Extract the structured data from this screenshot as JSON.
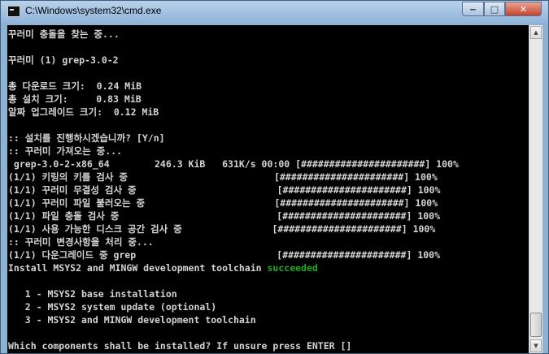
{
  "window": {
    "title": "C:\\Windows\\system32\\cmd.exe",
    "minimize_icon": "minimize-icon",
    "maximize_icon": "maximize-icon",
    "close_icon": "close-icon"
  },
  "console": {
    "lines": [
      {
        "text": "꾸러미 충돌을 찾는 중..."
      },
      {
        "text": ""
      },
      {
        "text": "꾸러미 (1) grep-3.0-2"
      },
      {
        "text": ""
      },
      {
        "text": "총 다운로드 크기:  0.24 MiB"
      },
      {
        "text": "총 설치 크기:     0.83 MiB"
      },
      {
        "text": "알짜 업그레이드 크기:  0.12 MiB"
      },
      {
        "text": ""
      },
      {
        "text": ":: 설치를 진행하시겠습니까? [Y/n]"
      },
      {
        "text": ":: 꾸러미 가져오는 중..."
      },
      {
        "text": " grep-3.0-2-x86_64        246.3 KiB   631K/s 00:00 [######################] 100%"
      },
      {
        "text": "(1/1) 키링의 키를 검사 중                          [######################] 100%"
      },
      {
        "text": "(1/1) 꾸러미 무결성 검사 중                         [######################] 100%"
      },
      {
        "text": "(1/1) 꾸러미 파일 불러오는 중                       [######################] 100%"
      },
      {
        "text": "(1/1) 파일 충돌 검사 중                            [######################] 100%"
      },
      {
        "text": "(1/1) 사용 가능한 디스크 공간 검사 중                [######################] 100%"
      },
      {
        "text": ":: 꾸러미 변경사항을 처리 중..."
      },
      {
        "text": "(1/1) 다운그레이드 중 grep                         [######################] 100%"
      },
      {
        "text": "Install MSYS2 and MINGW development toolchain ",
        "status": "succeeded"
      },
      {
        "text": ""
      },
      {
        "text": "   1 - MSYS2 base installation"
      },
      {
        "text": "   2 - MSYS2 system update (optional)"
      },
      {
        "text": "   3 - MSYS2 and MINGW development toolchain"
      },
      {
        "text": ""
      },
      {
        "text": "Which components shall be installed? If unsure press ENTER []"
      }
    ]
  },
  "colors": {
    "background": "#000000",
    "foreground": "#d4d4d4",
    "success": "#22a822"
  }
}
